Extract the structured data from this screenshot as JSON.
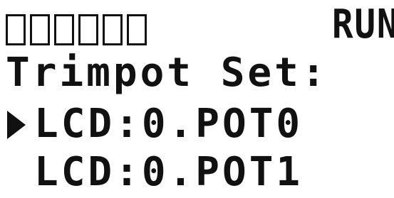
{
  "status": {
    "indicator_boxes": [
      "",
      "",
      "",
      "",
      "",
      ""
    ],
    "mode": "RUN"
  },
  "screen": {
    "title": "Trimpot Set:"
  },
  "menu": {
    "items": [
      {
        "label": "LCD:0.POT0",
        "selected": true
      },
      {
        "label": "LCD:0.POT1",
        "selected": false
      }
    ]
  },
  "icons": {
    "cursor": "selection-arrow-icon"
  },
  "colors": {
    "background": "#ffffff",
    "foreground": "#111111"
  }
}
